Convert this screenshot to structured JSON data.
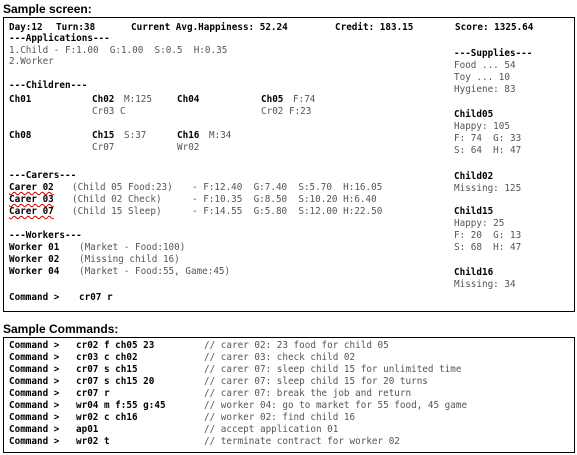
{
  "headings": {
    "screen": "Sample screen:",
    "commands": "Sample Commands:"
  },
  "status": {
    "day": "Day:12",
    "turn": "Turn:38",
    "avg_happiness": "Current Avg.Happiness: 52.24",
    "credit": "Credit: 183.15",
    "score": "Score: 1325.64"
  },
  "applications": {
    "header": "---Applications---",
    "rows": [
      "1.Child - F:1.00  G:1.00  S:0.5  H:0.35",
      "2.Worker"
    ]
  },
  "children": {
    "header": "---Children---",
    "row1": [
      {
        "id": "Ch01",
        "line1": "",
        "line2": ""
      },
      {
        "id": "Ch02",
        "line1": "M:125",
        "line2": "Cr03 C"
      },
      {
        "id": "Ch04",
        "line1": "",
        "line2": ""
      },
      {
        "id": "Ch05",
        "line1": "F:74",
        "line2": "Cr02 F:23"
      }
    ],
    "row2": [
      {
        "id": "Ch08",
        "line1": "",
        "line2": ""
      },
      {
        "id": "Ch15",
        "line1": "S:37",
        "line2": "Cr07"
      },
      {
        "id": "Ch16",
        "line1": "M:34",
        "line2": "Wr02"
      }
    ]
  },
  "carers": {
    "header": "---Carers---",
    "rows": [
      {
        "name": "Carer 02",
        "task": "(Child 05 Food:23)",
        "stats": "- F:12.40  G:7.40  S:5.70  H:16.05"
      },
      {
        "name": "Carer 03",
        "task": "(Child 02 Check)",
        "stats": "- F:10.35  G:8.50  S:10.20 H:6.40"
      },
      {
        "name": "Carer 07",
        "task": "(Child 15 Sleep)",
        "stats": "- F:14.55  G:5.80  S:12.00 H:22.50"
      }
    ]
  },
  "workers": {
    "header": "---Workers---",
    "rows": [
      {
        "name": "Worker 01",
        "task": "(Market - Food:100)"
      },
      {
        "name": "Worker 02",
        "task": "(Missing child 16)"
      },
      {
        "name": "Worker 04",
        "task": "(Market - Food:55, Game:45)"
      }
    ]
  },
  "prompt": {
    "label": "Command >",
    "value": "cr07 r"
  },
  "supplies": {
    "header": "---Supplies---",
    "food": "Food ... 54",
    "toy": "Toy ... 10",
    "hygiene": "Hygiene: 83"
  },
  "side_children": [
    {
      "id": "Child05",
      "lines": [
        "Happy: 105",
        "F: 74  G: 33",
        "S: 64  H: 47"
      ]
    },
    {
      "id": "Child02",
      "lines": [
        "Missing: 125"
      ]
    },
    {
      "id": "Child15",
      "lines": [
        "Happy: 25",
        "F: 20  G: 13",
        "S: 68  H: 47"
      ]
    },
    {
      "id": "Child16",
      "lines": [
        "Missing: 34"
      ]
    }
  ],
  "commands": [
    {
      "cmd": "cr02 f ch05 23",
      "desc": "// carer 02: 23 food for child 05"
    },
    {
      "cmd": "cr03 c ch02",
      "desc": "// carer 03: check child 02"
    },
    {
      "cmd": "cr07 s ch15",
      "desc": "// carer 07: sleep child 15 for unlimited time"
    },
    {
      "cmd": "cr07 s ch15 20",
      "desc": "// carer 07: sleep child 15 for 20 turns"
    },
    {
      "cmd": "cr07 r",
      "desc": "// carer 07: break the job and return"
    },
    {
      "cmd": "wr04 m f:55 g:45",
      "desc": "// worker 04: go to market for 55 food, 45 game"
    },
    {
      "cmd": "wr02 c ch16",
      "desc": "// worker 02: find child 16"
    },
    {
      "cmd": "ap01",
      "desc": "// accept application 01"
    },
    {
      "cmd": "wr02 t",
      "desc": "// terminate contract for worker 02"
    }
  ]
}
